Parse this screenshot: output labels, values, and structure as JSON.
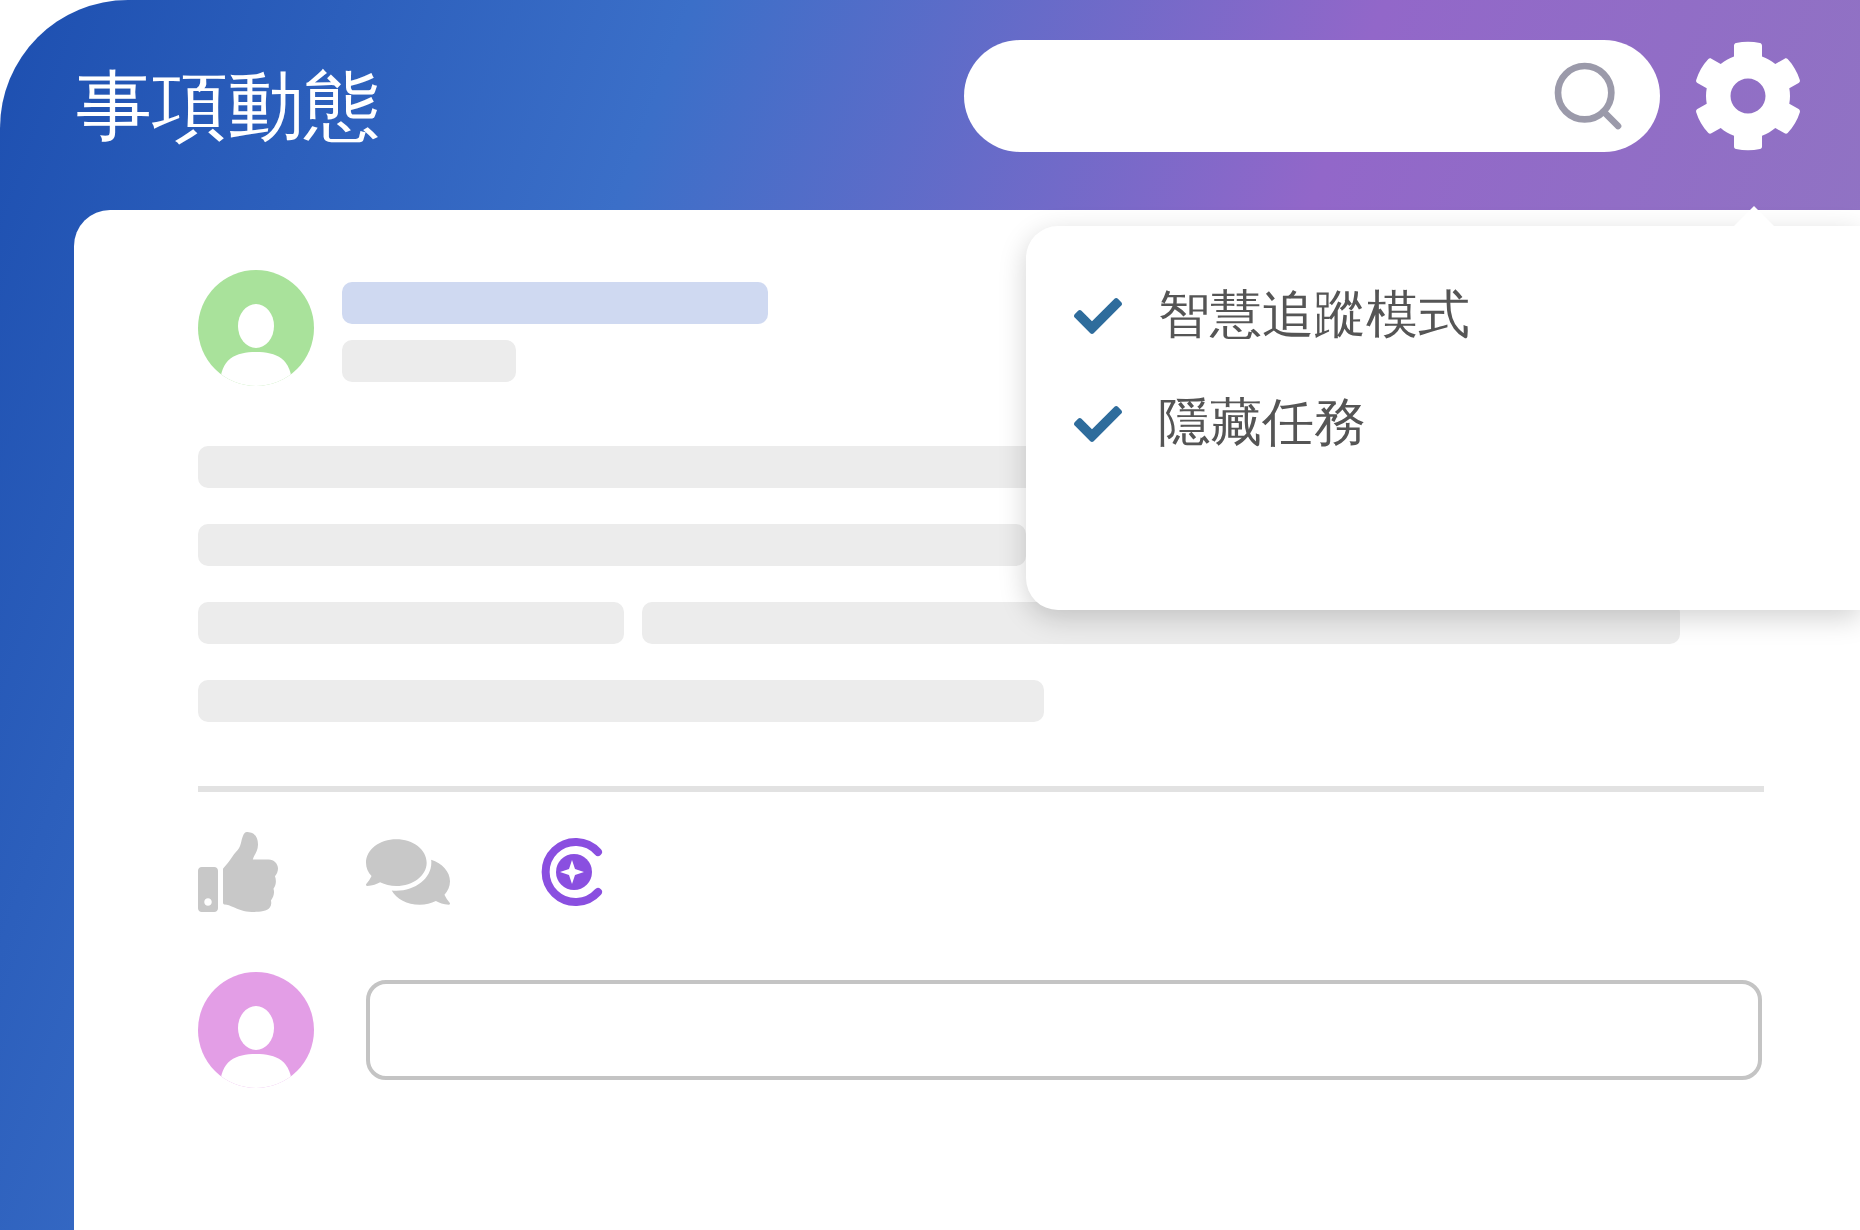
{
  "header": {
    "title": "事項動態"
  },
  "settings_menu": {
    "expanded": true,
    "items": [
      {
        "label": "智慧追蹤模式",
        "checked": true
      },
      {
        "label": "隱藏任務",
        "checked": true
      }
    ]
  }
}
